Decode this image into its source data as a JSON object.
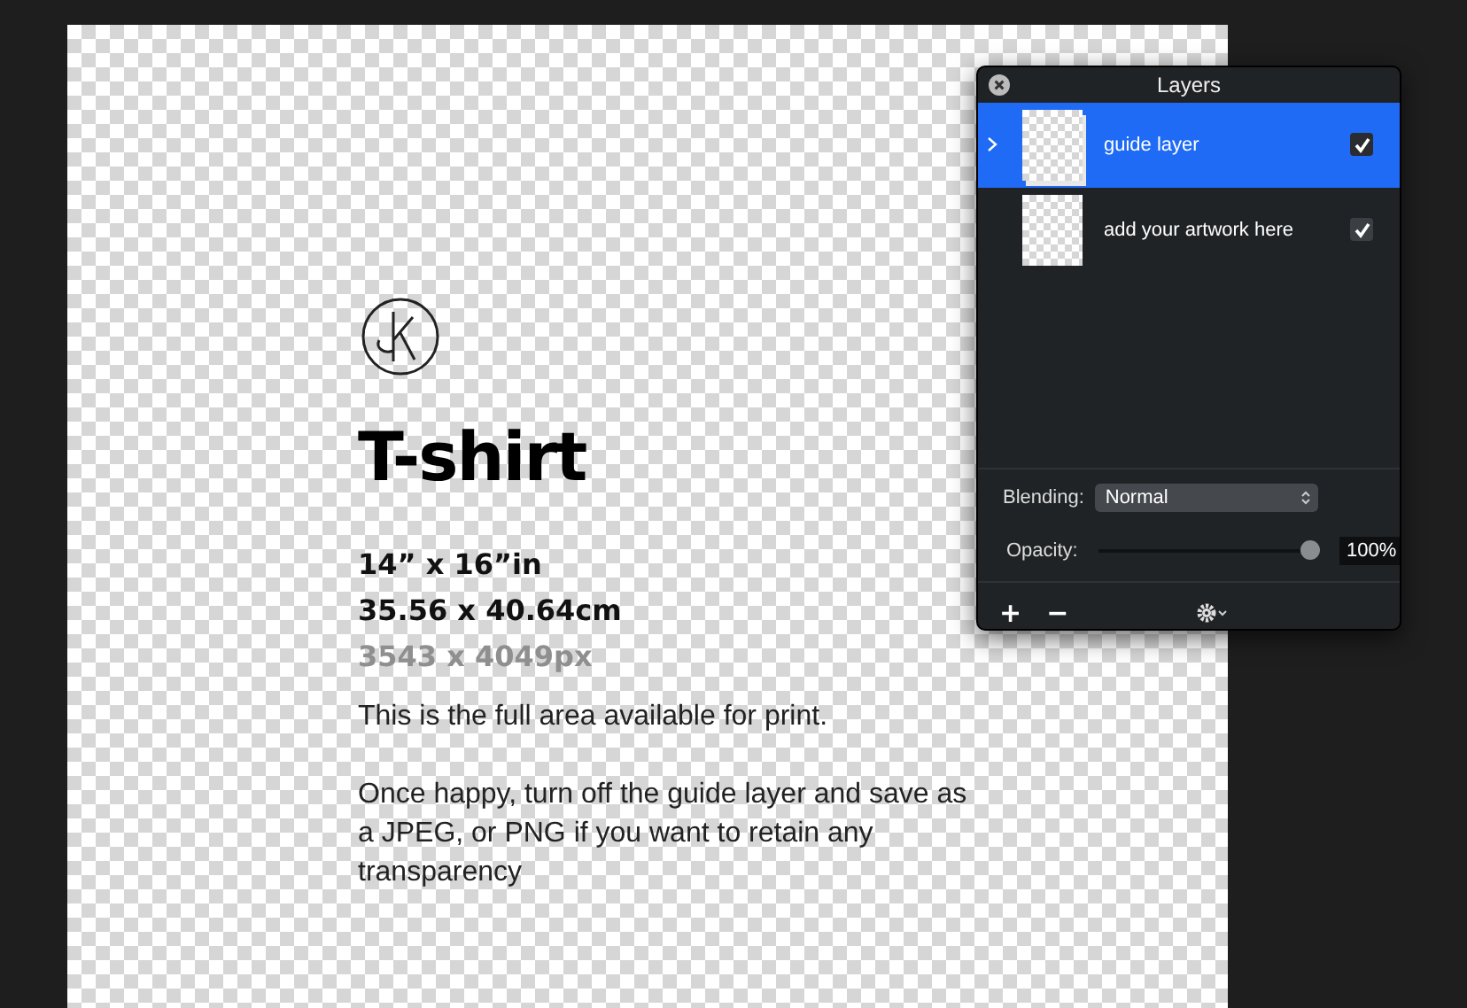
{
  "canvas": {
    "title": "T-shirt",
    "sizes": [
      {
        "text": "14” x 16”in",
        "muted": false
      },
      {
        "text": "35.56 x 40.64cm",
        "muted": false
      },
      {
        "text": "3543 x 4049px",
        "muted": true
      }
    ],
    "paragraphs": [
      "This is the full area available for print.",
      "Once happy, turn off the guide layer and save as a JPEG, or PNG if you want to retain any transparency"
    ]
  },
  "layers_panel": {
    "title": "Layers",
    "layers": [
      {
        "name": "guide layer",
        "kind": "group",
        "selected": true,
        "visible": true
      },
      {
        "name": "add your artwork here",
        "kind": "layer",
        "selected": false,
        "visible": true
      }
    ],
    "blending": {
      "label": "Blending:",
      "value": "Normal"
    },
    "opacity": {
      "label": "Opacity:",
      "level": 1,
      "reading": "100%"
    },
    "buttons": [
      "+",
      "−"
    ]
  }
}
